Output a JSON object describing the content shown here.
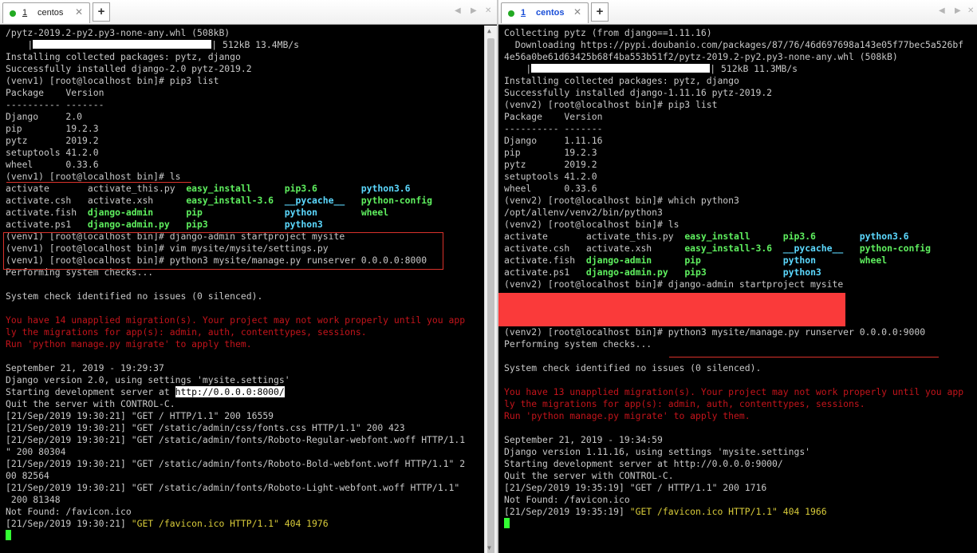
{
  "left": {
    "tab": {
      "number": "1",
      "name": "centos"
    },
    "lines": [
      [
        {
          "t": "/pytz-2019.2-py2.py3-none-any.whl (508kB)"
        }
      ],
      [
        {
          "t": "    |"
        },
        {
          "bar": true
        },
        {
          "t": "| 512kB 13.4MB/s"
        }
      ],
      [
        {
          "t": "Installing collected packages: pytz, django"
        }
      ],
      [
        {
          "t": "Successfully installed django-2.0 pytz-2019.2"
        }
      ],
      [
        {
          "t": "(venv1) [root@localhost bin]# pip3 list"
        }
      ],
      [
        {
          "t": "Package    Version"
        }
      ],
      [
        {
          "t": "---------- -------"
        }
      ],
      [
        {
          "t": "Django     2.0"
        }
      ],
      [
        {
          "t": "pip        19.2.3"
        }
      ],
      [
        {
          "t": "pytz       2019.2"
        }
      ],
      [
        {
          "t": "setuptools 41.2.0"
        }
      ],
      [
        {
          "t": "wheel      0.33.6"
        }
      ],
      [
        {
          "t": "(venv1) [root@localhost bin]# ls"
        }
      ],
      [
        {
          "t": "activate       activate_this.py  "
        },
        {
          "t": "easy_install",
          "c": "grn"
        },
        {
          "t": "      "
        },
        {
          "t": "pip3.6",
          "c": "grn"
        },
        {
          "t": "        "
        },
        {
          "t": "python3.6",
          "c": "cyn"
        }
      ],
      [
        {
          "t": "activate.csh   activate.xsh      "
        },
        {
          "t": "easy_install-3.6",
          "c": "grn"
        },
        {
          "t": "  "
        },
        {
          "t": "__pycache__",
          "c": "cyn"
        },
        {
          "t": "   "
        },
        {
          "t": "python-config",
          "c": "grn"
        }
      ],
      [
        {
          "t": "activate.fish  "
        },
        {
          "t": "django-admin",
          "c": "grn"
        },
        {
          "t": "      "
        },
        {
          "t": "pip",
          "c": "grn"
        },
        {
          "t": "               "
        },
        {
          "t": "python",
          "c": "cyn"
        },
        {
          "t": "        "
        },
        {
          "t": "wheel",
          "c": "grn"
        }
      ],
      [
        {
          "t": "activate.ps1   "
        },
        {
          "t": "django-admin.py",
          "c": "grn"
        },
        {
          "t": "   "
        },
        {
          "t": "pip3",
          "c": "grn"
        },
        {
          "t": "              "
        },
        {
          "t": "python3",
          "c": "cyn"
        }
      ],
      [
        {
          "t": "(venv1) [root@localhost bin]# django-admin startproject mysite"
        }
      ],
      [
        {
          "t": "(venv1) [root@localhost bin]# vim mysite/mysite/settings.py"
        }
      ],
      [
        {
          "t": "(venv1) [root@localhost bin]# python3 mysite/manage.py runserver 0.0.0.0:8000"
        }
      ],
      [
        {
          "t": "Performing system checks..."
        }
      ],
      [
        {
          "t": ""
        }
      ],
      [
        {
          "t": "System check identified no issues (0 silenced)."
        }
      ],
      [
        {
          "t": ""
        }
      ],
      [
        {
          "t": "You have 14 unapplied migration(s). Your project may not work properly until you app",
          "c": "err"
        }
      ],
      [
        {
          "t": "ly the migrations for app(s): admin, auth, contenttypes, sessions.",
          "c": "err"
        }
      ],
      [
        {
          "t": "Run 'python manage.py migrate' to apply them.",
          "c": "err"
        }
      ],
      [
        {
          "t": ""
        }
      ],
      [
        {
          "t": "September 21, 2019 - 19:29:37"
        }
      ],
      [
        {
          "t": "Django version 2.0, using settings 'mysite.settings'"
        }
      ],
      [
        {
          "t": "Starting development server at "
        },
        {
          "t": "http://0.0.0.0:8000/",
          "c": "hl"
        }
      ],
      [
        {
          "t": "Quit the server with CONTROL-C."
        }
      ],
      [
        {
          "t": "[21/Sep/2019 19:30:21] \"GET / HTTP/1.1\" 200 16559"
        }
      ],
      [
        {
          "t": "[21/Sep/2019 19:30:21] \"GET /static/admin/css/fonts.css HTTP/1.1\" 200 423"
        }
      ],
      [
        {
          "t": "[21/Sep/2019 19:30:21] \"GET /static/admin/fonts/Roboto-Regular-webfont.woff HTTP/1.1"
        }
      ],
      [
        {
          "t": "\" 200 80304"
        }
      ],
      [
        {
          "t": "[21/Sep/2019 19:30:21] \"GET /static/admin/fonts/Roboto-Bold-webfont.woff HTTP/1.1\" 2"
        }
      ],
      [
        {
          "t": "00 82564"
        }
      ],
      [
        {
          "t": "[21/Sep/2019 19:30:21] \"GET /static/admin/fonts/Roboto-Light-webfont.woff HTTP/1.1\""
        }
      ],
      [
        {
          "t": " 200 81348"
        }
      ],
      [
        {
          "t": "Not Found: /favicon.ico"
        }
      ],
      [
        {
          "t": "[21/Sep/2019 19:30:21] "
        },
        {
          "t": "\"GET /favicon.ico HTTP/1.1\" 404 1976",
          "c": "yel"
        }
      ],
      [
        {
          "cursor": true
        }
      ]
    ]
  },
  "right": {
    "tab": {
      "number": "1",
      "name": "centos"
    },
    "lines": [
      [
        {
          "t": "Collecting pytz (from django==1.11.16)"
        }
      ],
      [
        {
          "t": "  Downloading https://pypi.doubanio.com/packages/87/76/46d697698a143e05f77bec5a526bf"
        }
      ],
      [
        {
          "t": "4e56a0be61d63425b68f4ba553b51f2/pytz-2019.2-py2.py3-none-any.whl (508kB)"
        }
      ],
      [
        {
          "t": "    |"
        },
        {
          "bar": true
        },
        {
          "t": "| 512kB 11.3MB/s"
        }
      ],
      [
        {
          "t": "Installing collected packages: pytz, django"
        }
      ],
      [
        {
          "t": "Successfully installed django-1.11.16 pytz-2019.2"
        }
      ],
      [
        {
          "t": "(venv2) [root@localhost bin]# pip3 list"
        }
      ],
      [
        {
          "t": "Package    Version"
        }
      ],
      [
        {
          "t": "---------- -------"
        }
      ],
      [
        {
          "t": "Django     1.11.16"
        }
      ],
      [
        {
          "t": "pip        19.2.3"
        }
      ],
      [
        {
          "t": "pytz       2019.2"
        }
      ],
      [
        {
          "t": "setuptools 41.2.0"
        }
      ],
      [
        {
          "t": "wheel      0.33.6"
        }
      ],
      [
        {
          "t": "(venv2) [root@localhost bin]# which python3"
        }
      ],
      [
        {
          "t": "/opt/allenv/venv2/bin/python3"
        }
      ],
      [
        {
          "t": "(venv2) [root@localhost bin]# ls"
        }
      ],
      [
        {
          "t": "activate       activate_this.py  "
        },
        {
          "t": "easy_install",
          "c": "grn"
        },
        {
          "t": "      "
        },
        {
          "t": "pip3.6",
          "c": "grn"
        },
        {
          "t": "        "
        },
        {
          "t": "python3.6",
          "c": "cyn"
        }
      ],
      [
        {
          "t": "activate.csh   activate.xsh      "
        },
        {
          "t": "easy_install-3.6",
          "c": "grn"
        },
        {
          "t": "  "
        },
        {
          "t": "__pycache__",
          "c": "cyn"
        },
        {
          "t": "   "
        },
        {
          "t": "python-config",
          "c": "grn"
        }
      ],
      [
        {
          "t": "activate.fish  "
        },
        {
          "t": "django-admin",
          "c": "grn"
        },
        {
          "t": "      "
        },
        {
          "t": "pip",
          "c": "grn"
        },
        {
          "t": "               "
        },
        {
          "t": "python",
          "c": "cyn"
        },
        {
          "t": "        "
        },
        {
          "t": "wheel",
          "c": "grn"
        }
      ],
      [
        {
          "t": "activate.ps1   "
        },
        {
          "t": "django-admin.py",
          "c": "grn"
        },
        {
          "t": "   "
        },
        {
          "t": "pip3",
          "c": "grn"
        },
        {
          "t": "              "
        },
        {
          "t": "python3",
          "c": "cyn"
        }
      ],
      [
        {
          "t": "(venv2) [root@localhost bin]# django-admin startproject mysite"
        }
      ],
      [
        {
          "t": ""
        }
      ],
      [
        {
          "t": ""
        }
      ],
      [
        {
          "t": "(venv2) [root@localhost bin]# vim mysite/mysite/settings.py"
        }
      ],
      [
        {
          "t": "(venv2) [root@localhost bin]# python3 mysite/manage.py runserver 0.0.0.0:9000"
        }
      ],
      [
        {
          "t": "Performing system checks..."
        }
      ],
      [
        {
          "t": ""
        }
      ],
      [
        {
          "t": "System check identified no issues (0 silenced)."
        }
      ],
      [
        {
          "t": ""
        }
      ],
      [
        {
          "t": "You have 13 unapplied migration(s). Your project may not work properly until you app",
          "c": "err"
        }
      ],
      [
        {
          "t": "ly the migrations for app(s): admin, auth, contenttypes, sessions.",
          "c": "err"
        }
      ],
      [
        {
          "t": "Run 'python manage.py migrate' to apply them.",
          "c": "err"
        }
      ],
      [
        {
          "t": ""
        }
      ],
      [
        {
          "t": "September 21, 2019 - 19:34:59"
        }
      ],
      [
        {
          "t": "Django version 1.11.16, using settings 'mysite.settings'"
        }
      ],
      [
        {
          "t": "Starting development server at http://0.0.0.0:9000/"
        }
      ],
      [
        {
          "t": "Quit the server with CONTROL-C."
        }
      ],
      [
        {
          "t": "[21/Sep/2019 19:35:19] \"GET / HTTP/1.1\" 200 1716"
        }
      ],
      [
        {
          "t": "Not Found: /favicon.ico"
        }
      ],
      [
        {
          "t": "[21/Sep/2019 19:35:19] "
        },
        {
          "t": "\"GET /favicon.ico HTTP/1.1\" 404 1966",
          "c": "yel"
        }
      ],
      [
        {
          "cursor": true
        }
      ]
    ]
  },
  "colors": {
    "error": "#c4141b",
    "exec": "#5ff05f",
    "dir": "#5cd9ff",
    "warn_log": "#d9cc3a",
    "annotation": "#d9322b",
    "redaction": "#fa3a3a"
  },
  "icons": [
    "status-dot-icon",
    "close-icon",
    "plus-icon",
    "arrow-left-icon",
    "arrow-right-icon",
    "close-all-icon"
  ]
}
